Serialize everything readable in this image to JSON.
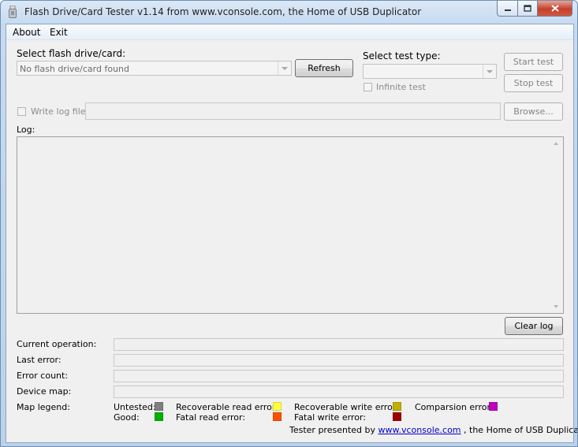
{
  "window": {
    "title": "Flash Drive/Card Tester v1.14 from www.vconsole.com, the Home of USB Duplicator",
    "icon": "usb-drive-icon",
    "caption_buttons": {
      "minimize": "minimize-icon",
      "maximize": "maximize-icon",
      "close": "close-icon"
    }
  },
  "menu": {
    "items": [
      "About",
      "Exit"
    ]
  },
  "drive": {
    "label": "Select flash drive/card:",
    "selected": "No flash drive/card found",
    "refresh_label": "Refresh"
  },
  "test": {
    "label": "Select test type:",
    "selected": "",
    "infinite_label": "Infinite test",
    "start_label": "Start test",
    "stop_label": "Stop test"
  },
  "logfile": {
    "checkbox_label": "Write log file",
    "path": "",
    "browse_label": "Browse..."
  },
  "log": {
    "label": "Log:",
    "content": "",
    "clear_label": "Clear log"
  },
  "status": {
    "current_operation_label": "Current operation:",
    "current_operation": "",
    "last_error_label": "Last error:",
    "last_error": "",
    "error_count_label": "Error count:",
    "error_count": "",
    "device_map_label": "Device map:"
  },
  "legend": {
    "label": "Map legend:",
    "items": [
      {
        "label": "Untested:",
        "color": "#808080"
      },
      {
        "label": "Recoverable read error:",
        "color": "#ffff40"
      },
      {
        "label": "Recoverable write error:",
        "color": "#c0b000"
      },
      {
        "label": "Comparsion error:",
        "color": "#c000c0"
      },
      {
        "label": "Good:",
        "color": "#00b000"
      },
      {
        "label": "Fatal read error:",
        "color": "#ff5000"
      },
      {
        "label": "Fatal write error:",
        "color": "#a00000"
      }
    ]
  },
  "footer": {
    "prefix": "Tester presented by",
    "link": "www.vconsole.com",
    "suffix": ", the Home of USB Duplicator."
  }
}
